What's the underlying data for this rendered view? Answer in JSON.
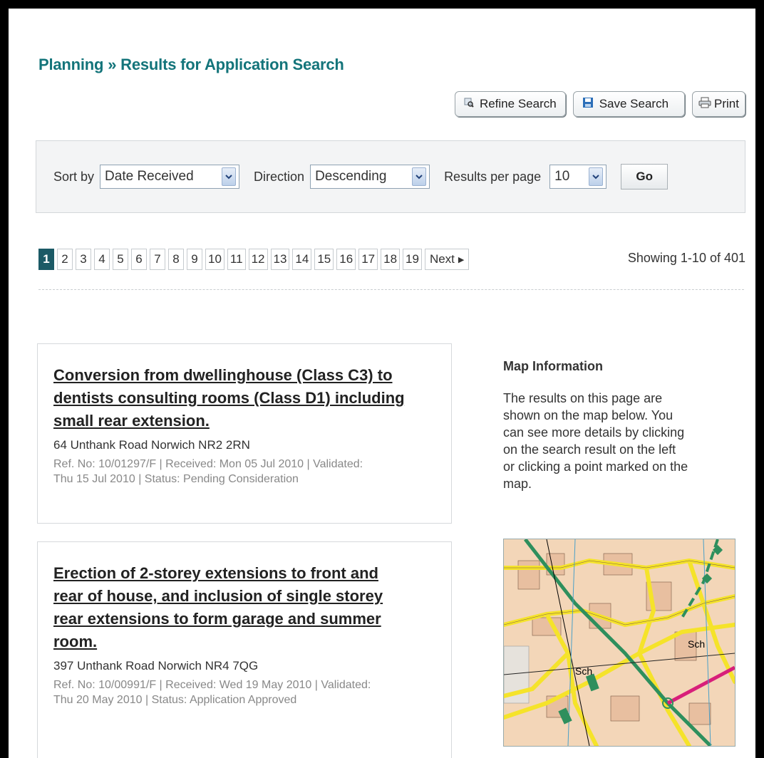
{
  "breadcrumb": {
    "section": "Planning",
    "sep": " » ",
    "page": "Results for Application Search"
  },
  "toolbar": {
    "refine": "Refine Search",
    "save": "Save Search",
    "print": "Print"
  },
  "sort": {
    "sort_label": "Sort by",
    "sort_value": "Date Received",
    "direction_label": "Direction",
    "direction_value": "Descending",
    "rpp_label": "Results per page",
    "rpp_value": "10",
    "go": "Go"
  },
  "pager": {
    "pages": [
      "1",
      "2",
      "3",
      "4",
      "5",
      "6",
      "7",
      "8",
      "9",
      "10",
      "11",
      "12",
      "13",
      "14",
      "15",
      "16",
      "17",
      "18",
      "19"
    ],
    "current": "1",
    "next": "Next",
    "showing": "Showing 1-10 of 401"
  },
  "results": [
    {
      "title_lines": [
        "Conversion from dwellinghouse (Class C3) to",
        "dentists consulting rooms (Class D1) including",
        "small rear extension."
      ],
      "address": "64 Unthank Road Norwich NR2 2RN",
      "meta_lines": [
        "Ref. No: 10/01297/F | Received: Mon 05 Jul 2010 | Validated:",
        "Thu 15 Jul 2010 | Status: Pending Consideration"
      ]
    },
    {
      "title_lines": [
        "Erection of 2-storey extensions to front and",
        "rear of house, and inclusion of single storey",
        "rear extensions to form garage and summer",
        "room."
      ],
      "address": "397 Unthank Road Norwich NR4 7QG",
      "meta_lines": [
        "Ref. No: 10/00991/F | Received: Wed 19 May 2010 | Validated:",
        "Thu 20 May 2010 | Status: Application Approved"
      ]
    }
  ],
  "map_info": {
    "heading": "Map Information",
    "lines": [
      "The results on this page are",
      "shown on the map below. You",
      "can see more details by clicking",
      "on the search result on the left",
      "or clicking a point marked on the",
      "map."
    ],
    "map_labels": {
      "sch1": "Sch",
      "sch2": "Sch"
    }
  },
  "colors": {
    "brand": "#13747a",
    "pager_active": "#1b5a66",
    "map_bg": "#f3d6b8",
    "road_yellow": "#f5e32a",
    "road_green": "#2e8f5d"
  }
}
